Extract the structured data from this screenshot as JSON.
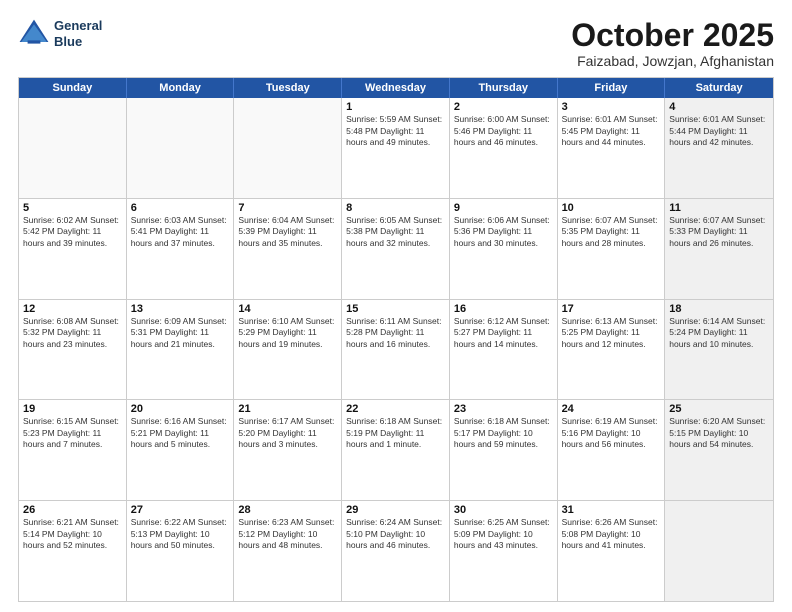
{
  "header": {
    "logo_line1": "General",
    "logo_line2": "Blue",
    "month": "October 2025",
    "location": "Faizabad, Jowzjan, Afghanistan"
  },
  "day_headers": [
    "Sunday",
    "Monday",
    "Tuesday",
    "Wednesday",
    "Thursday",
    "Friday",
    "Saturday"
  ],
  "weeks": [
    [
      {
        "day": "",
        "info": "",
        "empty": true
      },
      {
        "day": "",
        "info": "",
        "empty": true
      },
      {
        "day": "",
        "info": "",
        "empty": true
      },
      {
        "day": "1",
        "info": "Sunrise: 5:59 AM\nSunset: 5:48 PM\nDaylight: 11 hours\nand 49 minutes.",
        "empty": false
      },
      {
        "day": "2",
        "info": "Sunrise: 6:00 AM\nSunset: 5:46 PM\nDaylight: 11 hours\nand 46 minutes.",
        "empty": false
      },
      {
        "day": "3",
        "info": "Sunrise: 6:01 AM\nSunset: 5:45 PM\nDaylight: 11 hours\nand 44 minutes.",
        "empty": false
      },
      {
        "day": "4",
        "info": "Sunrise: 6:01 AM\nSunset: 5:44 PM\nDaylight: 11 hours\nand 42 minutes.",
        "empty": false,
        "shaded": true
      }
    ],
    [
      {
        "day": "5",
        "info": "Sunrise: 6:02 AM\nSunset: 5:42 PM\nDaylight: 11 hours\nand 39 minutes.",
        "empty": false
      },
      {
        "day": "6",
        "info": "Sunrise: 6:03 AM\nSunset: 5:41 PM\nDaylight: 11 hours\nand 37 minutes.",
        "empty": false
      },
      {
        "day": "7",
        "info": "Sunrise: 6:04 AM\nSunset: 5:39 PM\nDaylight: 11 hours\nand 35 minutes.",
        "empty": false
      },
      {
        "day": "8",
        "info": "Sunrise: 6:05 AM\nSunset: 5:38 PM\nDaylight: 11 hours\nand 32 minutes.",
        "empty": false
      },
      {
        "day": "9",
        "info": "Sunrise: 6:06 AM\nSunset: 5:36 PM\nDaylight: 11 hours\nand 30 minutes.",
        "empty": false
      },
      {
        "day": "10",
        "info": "Sunrise: 6:07 AM\nSunset: 5:35 PM\nDaylight: 11 hours\nand 28 minutes.",
        "empty": false
      },
      {
        "day": "11",
        "info": "Sunrise: 6:07 AM\nSunset: 5:33 PM\nDaylight: 11 hours\nand 26 minutes.",
        "empty": false,
        "shaded": true
      }
    ],
    [
      {
        "day": "12",
        "info": "Sunrise: 6:08 AM\nSunset: 5:32 PM\nDaylight: 11 hours\nand 23 minutes.",
        "empty": false
      },
      {
        "day": "13",
        "info": "Sunrise: 6:09 AM\nSunset: 5:31 PM\nDaylight: 11 hours\nand 21 minutes.",
        "empty": false
      },
      {
        "day": "14",
        "info": "Sunrise: 6:10 AM\nSunset: 5:29 PM\nDaylight: 11 hours\nand 19 minutes.",
        "empty": false
      },
      {
        "day": "15",
        "info": "Sunrise: 6:11 AM\nSunset: 5:28 PM\nDaylight: 11 hours\nand 16 minutes.",
        "empty": false
      },
      {
        "day": "16",
        "info": "Sunrise: 6:12 AM\nSunset: 5:27 PM\nDaylight: 11 hours\nand 14 minutes.",
        "empty": false
      },
      {
        "day": "17",
        "info": "Sunrise: 6:13 AM\nSunset: 5:25 PM\nDaylight: 11 hours\nand 12 minutes.",
        "empty": false
      },
      {
        "day": "18",
        "info": "Sunrise: 6:14 AM\nSunset: 5:24 PM\nDaylight: 11 hours\nand 10 minutes.",
        "empty": false,
        "shaded": true
      }
    ],
    [
      {
        "day": "19",
        "info": "Sunrise: 6:15 AM\nSunset: 5:23 PM\nDaylight: 11 hours\nand 7 minutes.",
        "empty": false
      },
      {
        "day": "20",
        "info": "Sunrise: 6:16 AM\nSunset: 5:21 PM\nDaylight: 11 hours\nand 5 minutes.",
        "empty": false
      },
      {
        "day": "21",
        "info": "Sunrise: 6:17 AM\nSunset: 5:20 PM\nDaylight: 11 hours\nand 3 minutes.",
        "empty": false
      },
      {
        "day": "22",
        "info": "Sunrise: 6:18 AM\nSunset: 5:19 PM\nDaylight: 11 hours\nand 1 minute.",
        "empty": false
      },
      {
        "day": "23",
        "info": "Sunrise: 6:18 AM\nSunset: 5:17 PM\nDaylight: 10 hours\nand 59 minutes.",
        "empty": false
      },
      {
        "day": "24",
        "info": "Sunrise: 6:19 AM\nSunset: 5:16 PM\nDaylight: 10 hours\nand 56 minutes.",
        "empty": false
      },
      {
        "day": "25",
        "info": "Sunrise: 6:20 AM\nSunset: 5:15 PM\nDaylight: 10 hours\nand 54 minutes.",
        "empty": false,
        "shaded": true
      }
    ],
    [
      {
        "day": "26",
        "info": "Sunrise: 6:21 AM\nSunset: 5:14 PM\nDaylight: 10 hours\nand 52 minutes.",
        "empty": false
      },
      {
        "day": "27",
        "info": "Sunrise: 6:22 AM\nSunset: 5:13 PM\nDaylight: 10 hours\nand 50 minutes.",
        "empty": false
      },
      {
        "day": "28",
        "info": "Sunrise: 6:23 AM\nSunset: 5:12 PM\nDaylight: 10 hours\nand 48 minutes.",
        "empty": false
      },
      {
        "day": "29",
        "info": "Sunrise: 6:24 AM\nSunset: 5:10 PM\nDaylight: 10 hours\nand 46 minutes.",
        "empty": false
      },
      {
        "day": "30",
        "info": "Sunrise: 6:25 AM\nSunset: 5:09 PM\nDaylight: 10 hours\nand 43 minutes.",
        "empty": false
      },
      {
        "day": "31",
        "info": "Sunrise: 6:26 AM\nSunset: 5:08 PM\nDaylight: 10 hours\nand 41 minutes.",
        "empty": false
      },
      {
        "day": "",
        "info": "",
        "empty": true,
        "shaded": true
      }
    ]
  ]
}
